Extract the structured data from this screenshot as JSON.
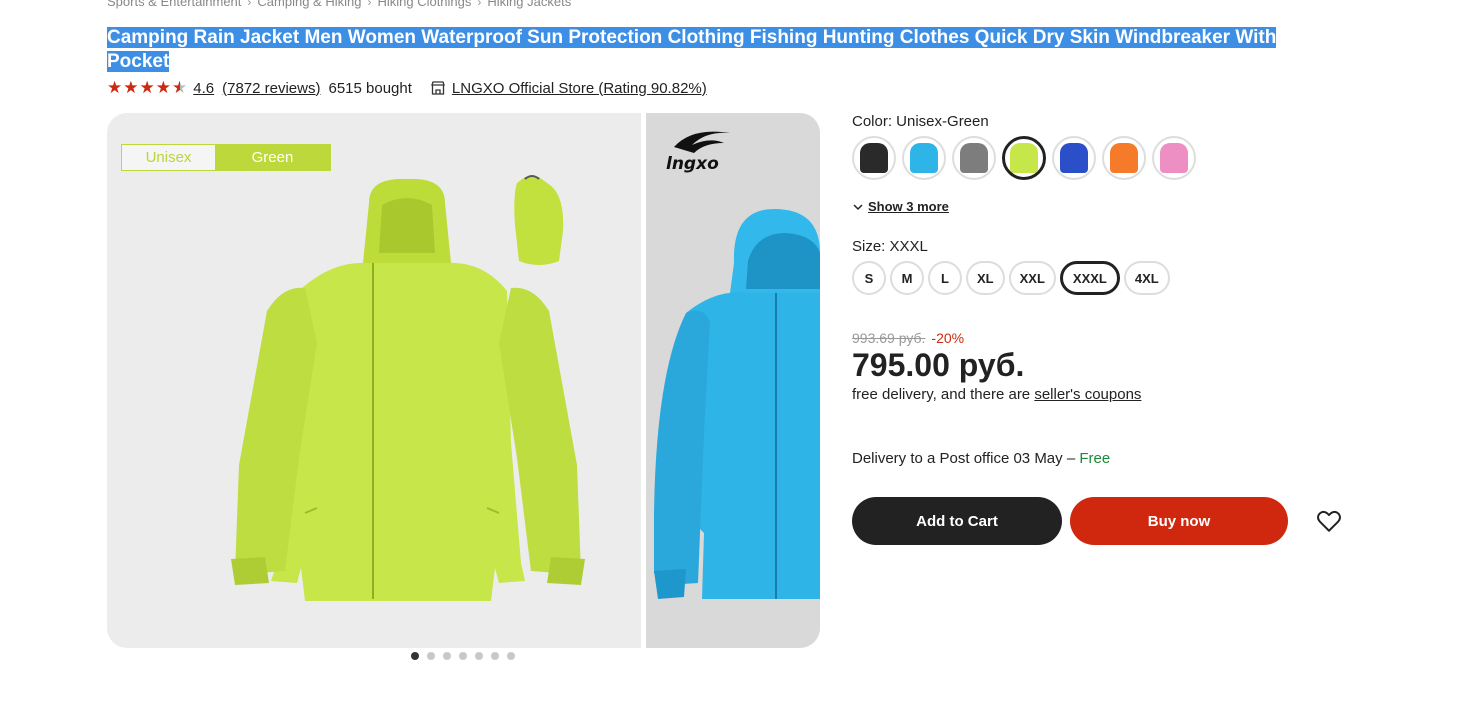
{
  "breadcrumb": [
    "Sports & Entertainment",
    "Camping & Hiking",
    "Hiking Clothings",
    "Hiking Jackets"
  ],
  "product": {
    "title": "Camping Rain Jacket Men Women Waterproof Sun Protection Clothing Fishing Hunting Clothes Quick Dry Skin Windbreaker With Pocket",
    "rating": "4.6",
    "rating_value": 4.6,
    "reviews": "(7872 reviews)",
    "bought": "6515 bought",
    "store": "LNGXO Official Store (Rating 90.82%)"
  },
  "gallery": {
    "tag_left": "Unisex",
    "tag_right": "Green",
    "brand_logo": "LNGXO",
    "slide_count": 7,
    "active_slide": 1,
    "colors": {
      "jacket_green": "#c6e64a",
      "jacket_blue": "#29b3e6"
    }
  },
  "color": {
    "label": "Color: Unisex-Green",
    "options": [
      {
        "name": "black",
        "hex": "#2a2a2a"
      },
      {
        "name": "sky-blue",
        "hex": "#2fb4e8"
      },
      {
        "name": "gray",
        "hex": "#7d7d7d"
      },
      {
        "name": "green",
        "hex": "#c6e64a"
      },
      {
        "name": "royal-blue",
        "hex": "#2a4fc8"
      },
      {
        "name": "orange",
        "hex": "#f57a2a"
      },
      {
        "name": "pink",
        "hex": "#ee8fc4"
      }
    ],
    "selected_index": 3,
    "show_more": "Show 3 more"
  },
  "size": {
    "label": "Size: XXXL",
    "options": [
      "S",
      "M",
      "L",
      "XL",
      "XXL",
      "XXXL",
      "4XL"
    ],
    "selected_index": 5
  },
  "pricing": {
    "old_price": "993.69 руб.",
    "discount": "-20%",
    "price": "795.00 руб.",
    "delivery_text": "free delivery, and there are ",
    "coupons_link": "seller's coupons"
  },
  "delivery": {
    "text": "Delivery to a Post office 03 May – ",
    "free": "Free"
  },
  "actions": {
    "add_to_cart": "Add to Cart",
    "buy_now": "Buy now"
  }
}
